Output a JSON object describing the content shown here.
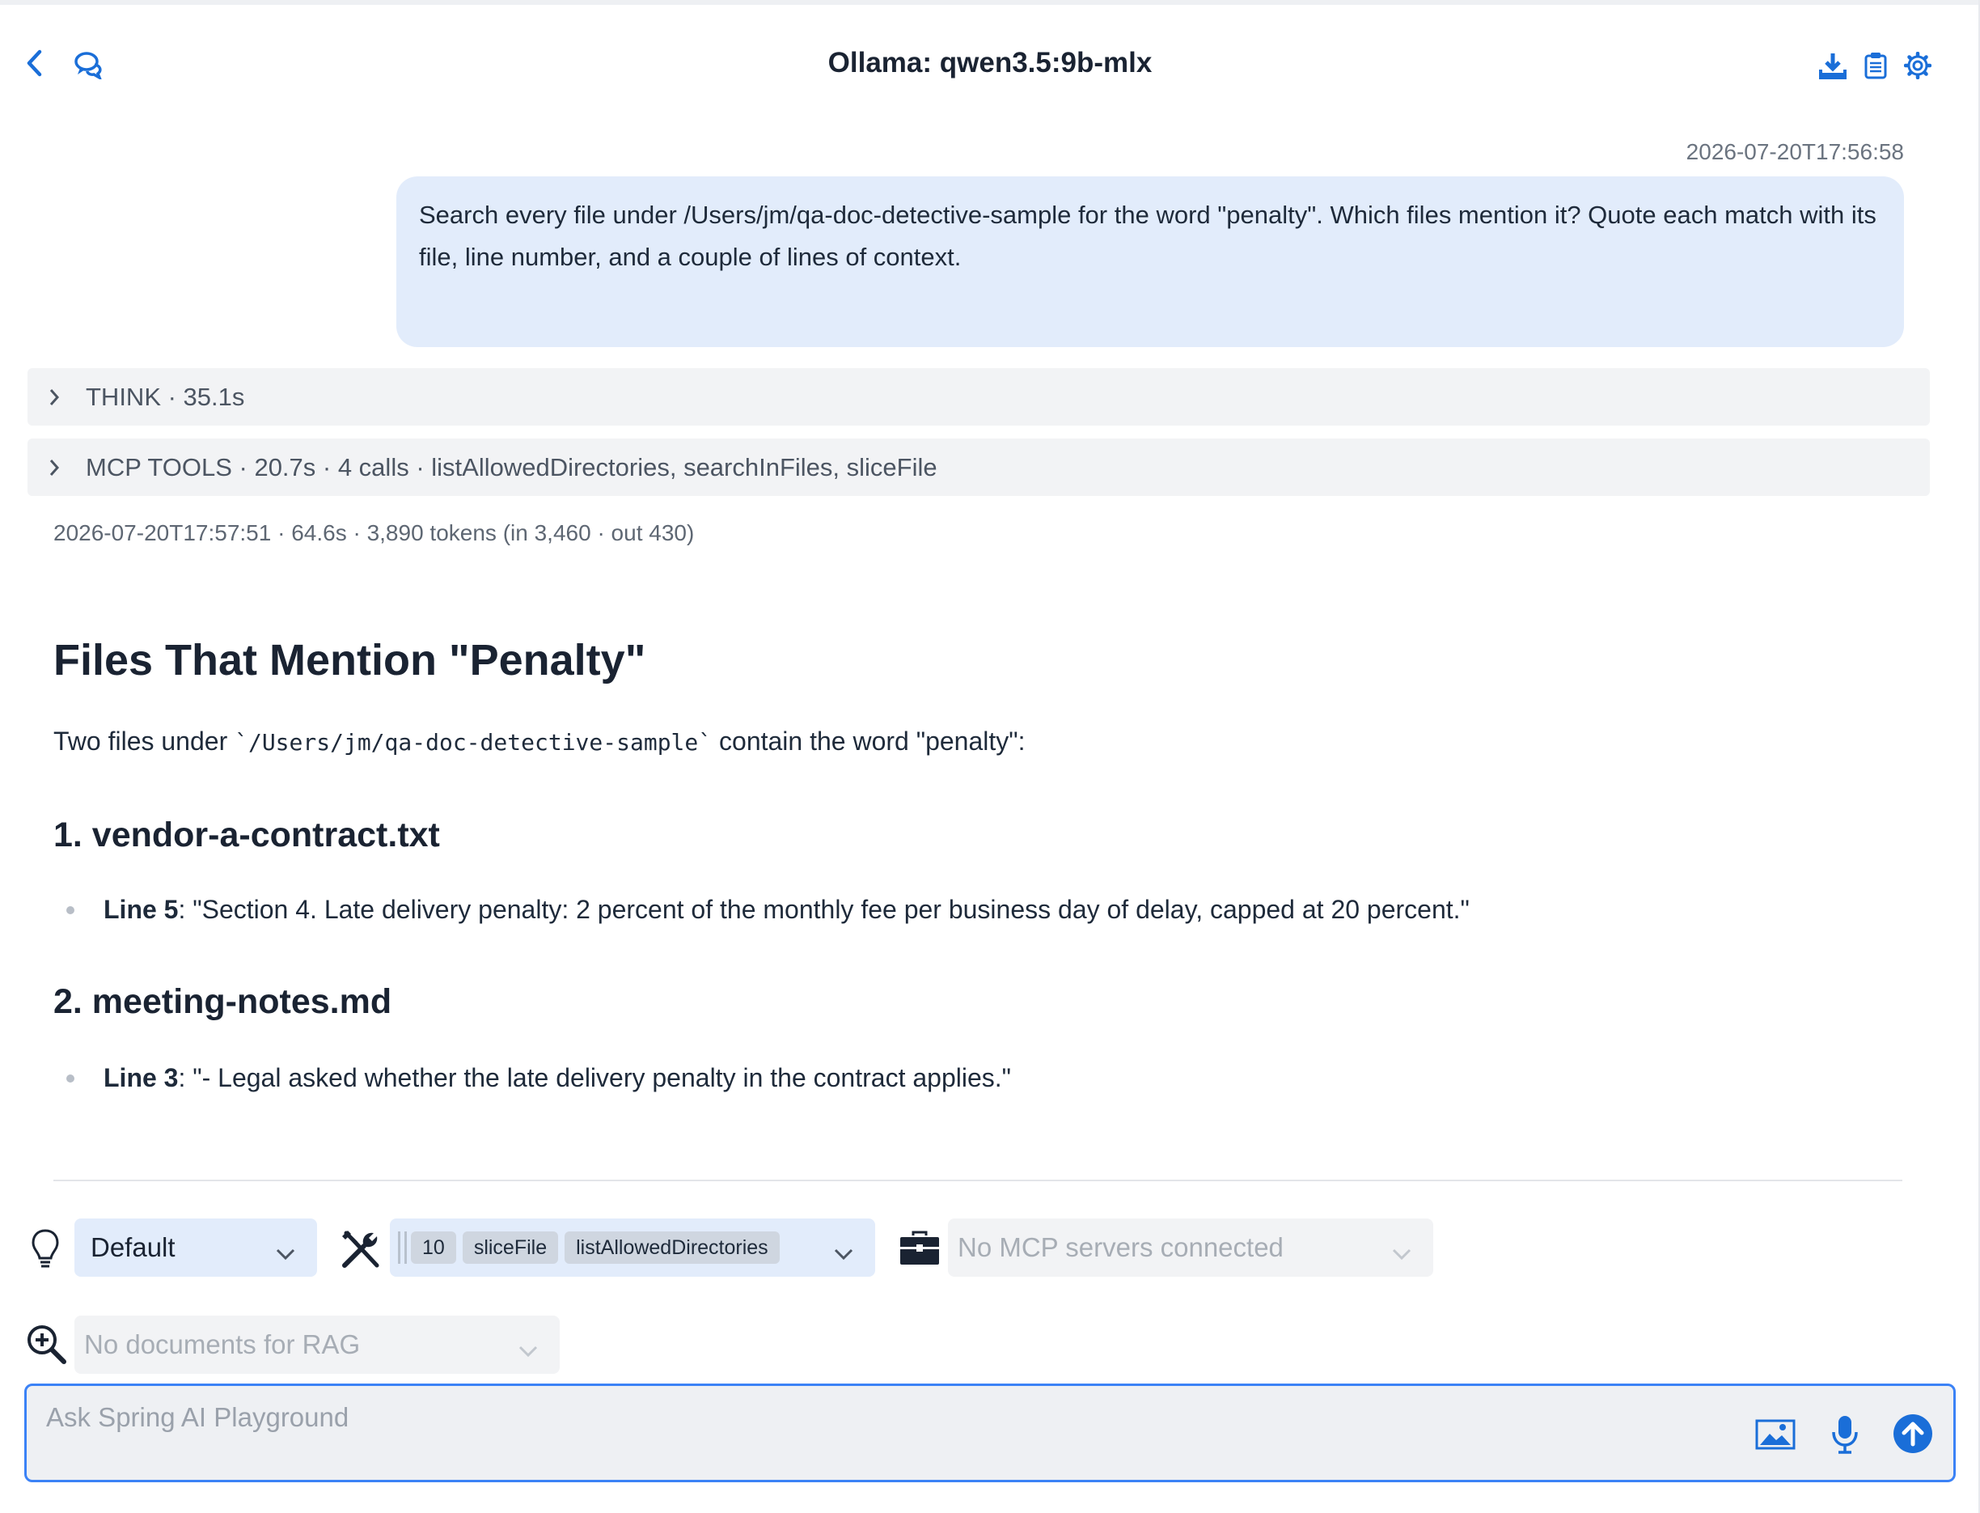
{
  "header": {
    "title": "Ollama: qwen3.5:9b-mlx",
    "icons": [
      "back-icon",
      "chat-history-icon",
      "download-icon",
      "clipboard-icon",
      "gear-icon"
    ]
  },
  "user_message": {
    "timestamp": "2026-07-20T17:56:58",
    "text": "Search every file under /Users/jm/qa-doc-detective-sample for the word \"penalty\". Which files mention it? Quote each match with its file, line number, and a couple of lines of context."
  },
  "think": {
    "label": "THINK · 35.1s"
  },
  "mcp_tools": {
    "label": "MCP TOOLS · 20.7s · 4 calls · listAllowedDirectories, searchInFiles, sliceFile"
  },
  "response_meta": "2026-07-20T17:57:51 · 64.6s · 3,890 tokens (in 3,460 · out 430)",
  "answer": {
    "heading": "Files That Mention \"Penalty\"",
    "intro_before": "Two files under ",
    "intro_code": "`/Users/jm/qa-doc-detective-sample`",
    "intro_after": " contain the word \"penalty\":",
    "files": [
      {
        "heading": "1. vendor-a-contract.txt",
        "line_label": "Line 5",
        "quote": ": \"Section 4. Late delivery penalty: 2 percent of the monthly fee per business day of delay, capped at 20 percent.\""
      },
      {
        "heading": "2. meeting-notes.md",
        "line_label": "Line 3",
        "quote": ": \"- Legal asked whether the late delivery penalty in the contract applies.\""
      }
    ]
  },
  "controls": {
    "prompt_select": {
      "value": "Default",
      "icon": "lightbulb-icon"
    },
    "tools_select": {
      "count": "10",
      "chips": [
        "sliceFile",
        "listAllowedDirectories"
      ],
      "icon": "tools-icon"
    },
    "mcp_select": {
      "placeholder": "No MCP servers connected",
      "icon": "toolbox-icon"
    },
    "rag_select": {
      "placeholder": "No documents for RAG",
      "icon": "zoom-in-icon"
    }
  },
  "input": {
    "placeholder": "Ask Spring AI Playground",
    "icons": [
      "image-icon",
      "microphone-icon",
      "send-icon"
    ]
  },
  "colors": {
    "accent": "#1a6ed8",
    "user_bubble": "#e2ecfb",
    "collapse_bg": "#f2f3f5",
    "input_border": "#3b82f6"
  }
}
